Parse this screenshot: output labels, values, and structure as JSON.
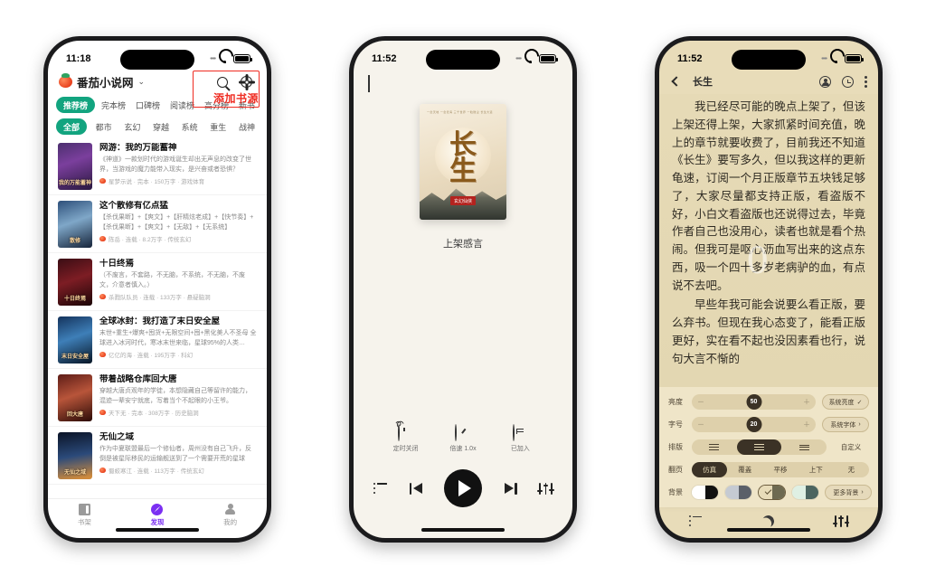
{
  "phones": [
    {
      "status": {
        "time": "11:18",
        "wifi_icon": "wifi-icon",
        "battery_icon": "battery-icon"
      },
      "header": {
        "brand": "番茄小说网",
        "chevron": "⌄",
        "search_icon": "search-icon",
        "settings_icon": "gear-icon",
        "annotation": "添加书源"
      },
      "tabs_row1": [
        "推荐榜",
        "完本榜",
        "口碑榜",
        "阅读榜",
        "高分榜",
        "新书"
      ],
      "tabs_row2": [
        "全部",
        "都市",
        "玄幻",
        "穿越",
        "系统",
        "重生",
        "战神"
      ],
      "books": [
        {
          "title": "网游：我的万能蓄神",
          "desc": "《神道》一款划时代的游戏诞生却出无声息的改变了世界，当游戏的魔力能带入现实，是兴奋或者恐惧？",
          "meta": "星梦示说 · 完本 · 150万字 · 游戏体育",
          "cover_text": "我的万能蓄神"
        },
        {
          "title": "这个散修有亿点猛",
          "desc": "【杀伐果断】+【爽文】+【肝精炫老成】+【快节奏】+【杀伐果断】+【爽文】+【无敌】+【无系统】",
          "meta": "陈岳 · 连载 · 8.2万字 · 传统玄幻",
          "cover_text": "散修"
        },
        {
          "title": "十日终焉",
          "desc": "（不废言，不套路，不无脑，不系统，不无脑，不废文，介意者慎入。）",
          "meta": "杀戮队队员 · 连载 · 133万字 · 悬疑脑洞",
          "cover_text": "十日终焉"
        },
        {
          "title": "全球冰封：我打造了末日安全屋",
          "desc": "末世+重生+爆爽+囤货+无限空间+囤+黑化美人不圣母  全球进入冰河时代，寒冰末世来临，星球95%的人类…",
          "meta": "亿亿的海 · 连载 · 195万字 · 科幻",
          "cover_text": "末日安全屋"
        },
        {
          "title": "带着战略仓库回大唐",
          "desc": "穿越大唐贞观年的学徒，本想隐藏自己等留许的能力，混迹一辈安宁就底，写着当个不起眼的小王爷。",
          "meta": "天下无 · 完本 · 308万字 · 历史脑洞",
          "cover_text": "回大唐"
        },
        {
          "title": "无仙之域",
          "desc": "作为中夏联盟最后一个修仙者，周州没有自己飞升，反倒是被星际移民的运输舰送到了一个需要开荒的星球上，为…",
          "meta": "蜀蛟寒江 · 连载 · 113万字 · 传统玄幻",
          "cover_text": "无仙之域"
        }
      ],
      "tabbar": [
        {
          "label": "书架",
          "icon": "bookshelf-icon",
          "active": false
        },
        {
          "label": "发现",
          "icon": "compass-icon",
          "active": true
        },
        {
          "label": "我的",
          "icon": "person-icon",
          "active": false
        }
      ],
      "accent_color": "#12a47f",
      "active_tab_color": "#7b2ff2",
      "annotation_color": "#ef2b21"
    },
    {
      "status": {
        "time": "11:52",
        "wifi_icon": "wifi-icon",
        "battery_icon": "battery-icon"
      },
      "collapse_icon": "chevron-down-icon",
      "cover": {
        "title": "长生",
        "top_caption": "一念天地 一念沧海 三千世界 一粒微尘 长生大道",
        "seal": "玄幻仙侠"
      },
      "chapter_title": "上架感言",
      "quick_actions": [
        {
          "label": "定时关闭",
          "icon": "alarm-icon"
        },
        {
          "label": "倍速 1.0x",
          "icon": "speed-icon"
        },
        {
          "label": "已加入",
          "icon": "added-icon"
        }
      ],
      "controls": [
        {
          "name": "playlist",
          "icon": "list-icon"
        },
        {
          "name": "previous",
          "icon": "previous-icon"
        },
        {
          "name": "play",
          "icon": "play-icon"
        },
        {
          "name": "next",
          "icon": "next-icon"
        },
        {
          "name": "equalizer",
          "icon": "equalizer-icon"
        }
      ]
    },
    {
      "status": {
        "time": "11:52",
        "wifi_icon": "wifi-icon",
        "battery_icon": "battery-icon"
      },
      "header": {
        "back_icon": "back-arrow-icon",
        "title": "长生",
        "account_icon": "account-circle-icon",
        "history_icon": "clock-circle-icon",
        "more_icon": "more-vertical-icon"
      },
      "paragraphs": [
        "我已经尽可能的晚点上架了，但该上架还得上架，大家抓紧时间充值，晚上的章节就要收费了，目前我还不知道《长生》要写多久，但以我这样的更新龟速，订阅一个月正版章节五块钱足够了，大家尽量都支持正版，看盗版不好，小白文看盗版也还说得过去，毕竟作者自己也没用心，读者也就是看个热闹。但我可是呕心沥血写出来的这点东西，吸一个四十多岁老病驴的血，有点说不去吧。",
        "早些年我可能会说要么看正版，要么弃书。但现在我心态变了，能看正版更好，实在看不起也没因素看也行，说句大言不惭的"
      ],
      "watermark": "0",
      "settings": {
        "brightness": {
          "label": "亮度",
          "value": "50",
          "minus": "－",
          "plus": "＋",
          "button": "系统亮度",
          "button_state": "✓"
        },
        "fontsize": {
          "label": "字号",
          "value": "20",
          "minus": "－",
          "plus": "＋",
          "button": "系统字体",
          "button_state": "›"
        },
        "layout": {
          "label": "排版",
          "options": [
            "loose-lines-icon",
            "medium-lines-icon",
            "tight-lines-icon"
          ],
          "selected_index": 1,
          "custom": "自定义"
        },
        "pageturn": {
          "label": "翻页",
          "options": [
            "仿真",
            "覆盖",
            "平移",
            "上下",
            "无"
          ],
          "selected_index": 0
        },
        "background": {
          "label": "背景",
          "more": "更多背景",
          "selected_index": 2,
          "swatches": [
            {
              "left": "#ffffff",
              "right": "#111111"
            },
            {
              "left": "#c5cad2",
              "right": "#5b6069"
            },
            {
              "left": "#e8dcb9",
              "right": "#6e6a51"
            },
            {
              "left": "#dff0e4",
              "right": "#4c6560"
            }
          ]
        }
      },
      "bottombar": [
        {
          "name": "catalog",
          "icon": "catalog-icon"
        },
        {
          "name": "night-mode",
          "icon": "moon-icon"
        },
        {
          "name": "settings",
          "icon": "settings-sliders-icon"
        }
      ]
    }
  ]
}
